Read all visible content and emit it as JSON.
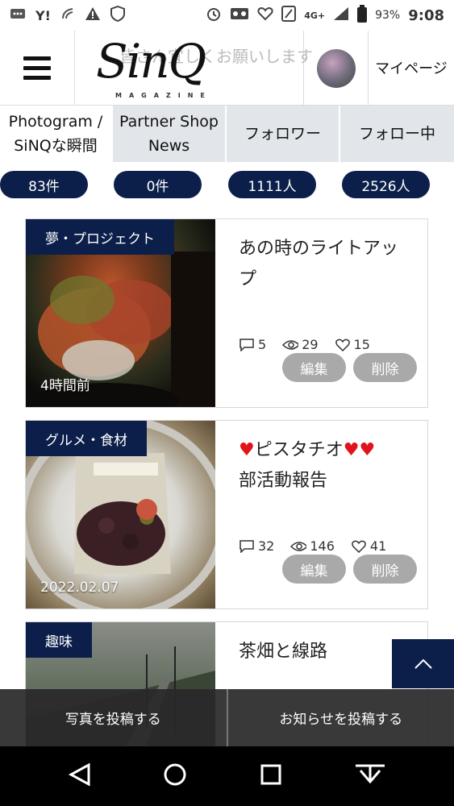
{
  "status_bar": {
    "battery": "93%",
    "time": "9:08",
    "network": "4G+"
  },
  "header": {
    "logo": "SinQ",
    "logo_sub": "MAGAZINE",
    "marquee": "皆さん宜しくお願いします",
    "mypage": "マイページ"
  },
  "tabs": [
    {
      "label": "Photogram /\nSiNQな瞬間"
    },
    {
      "label": "Partner Shop\nNews"
    },
    {
      "label": "フォロワー"
    },
    {
      "label": "フォロー中"
    }
  ],
  "counts": [
    "83件",
    "0件",
    "1111人",
    "2526人"
  ],
  "posts": [
    {
      "category": "夢・プロジェクト",
      "date": "4時間前",
      "title": "あの時のライトアップ",
      "comments": "5",
      "views": "29",
      "likes": "15",
      "edit": "編集",
      "delete": "削除"
    },
    {
      "category": "グルメ・食材",
      "date": "2022.02.07",
      "title_hearts_pre": "♥",
      "title": "ピスタチオ",
      "title_hearts_post": "♥♥",
      "title2": "部活動報告",
      "comments": "32",
      "views": "146",
      "likes": "41",
      "edit": "編集",
      "delete": "削除"
    },
    {
      "category": "趣味",
      "title": "茶畑と線路"
    }
  ],
  "actions": {
    "post_photo": "写真を投稿する",
    "post_news": "お知らせを投稿する"
  },
  "colors": {
    "navy": "#0b1f4a",
    "button_gray": "#a9a9a9",
    "heart_red": "#e0151b"
  }
}
